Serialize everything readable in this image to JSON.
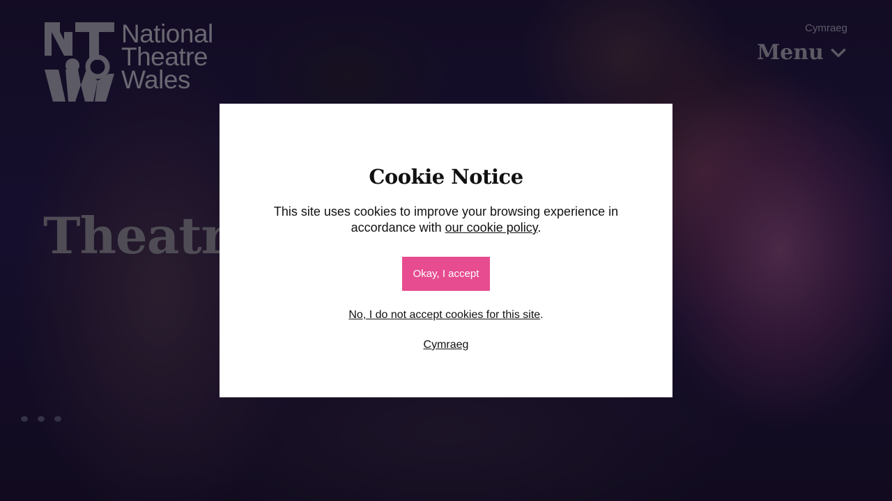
{
  "header": {
    "logo_lines": [
      "National",
      "Theatre",
      "Wales"
    ],
    "language_link": "Cymraeg",
    "menu_label": "Menu"
  },
  "hero": {
    "title": "Theatre"
  },
  "cookie_modal": {
    "title": "Cookie Notice",
    "body_text": "This site uses cookies to improve your browsing experience in accordance with ",
    "policy_link": "our cookie policy",
    "body_end": ".",
    "accept_label": "Okay, I accept",
    "decline_link": "No, I do not accept cookies for this site",
    "decline_end": ".",
    "language_link": "Cymraeg"
  },
  "colors": {
    "accent": "#e64c8f",
    "overlay": "#140f1f",
    "modal_bg": "#ffffff"
  },
  "icons": {
    "menu_chevron": "chevron-down-icon"
  }
}
